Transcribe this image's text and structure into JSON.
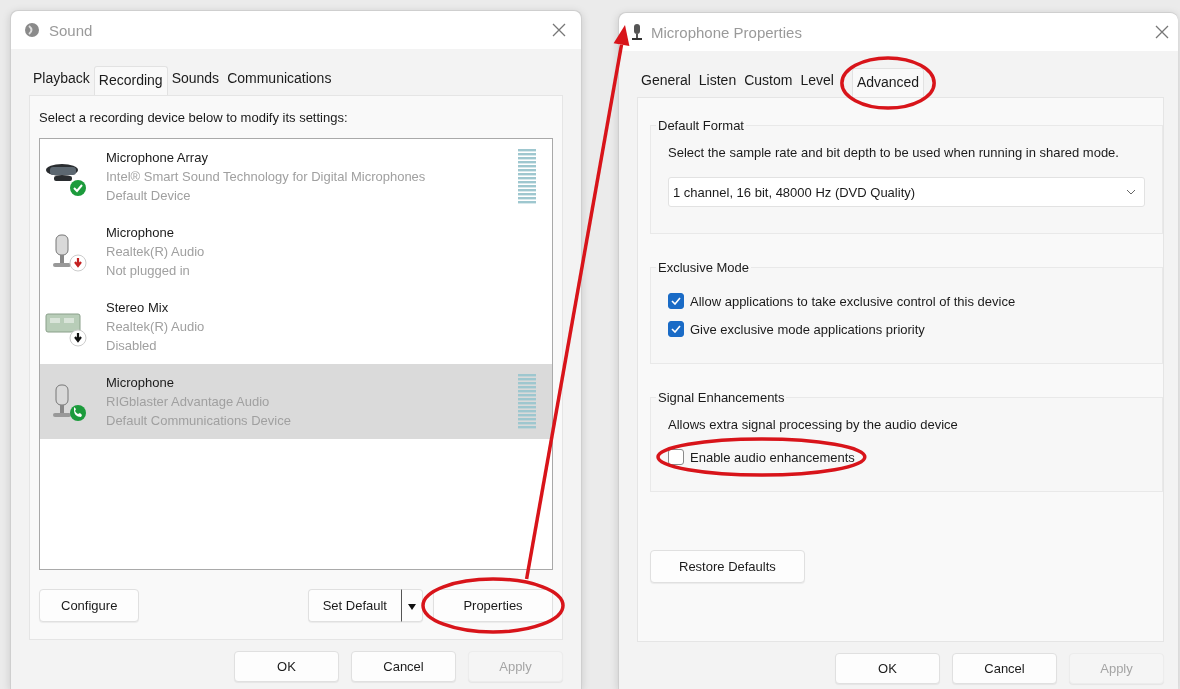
{
  "sound_window": {
    "title": "Sound",
    "tabs": [
      {
        "label": "Playback",
        "selected": false
      },
      {
        "label": "Recording",
        "selected": true
      },
      {
        "label": "Sounds",
        "selected": false
      },
      {
        "label": "Communications",
        "selected": false
      }
    ],
    "instruction": "Select a recording device below to modify its settings:",
    "devices": [
      {
        "name": "Microphone Array",
        "driver": "Intel® Smart Sound Technology for Digital Microphones",
        "status": "Default Device",
        "kind": "webcam",
        "default": true,
        "communications_default": false,
        "unplugged": false,
        "disabled": false,
        "meter": true,
        "selected": false
      },
      {
        "name": "Microphone",
        "driver": "Realtek(R) Audio",
        "status": "Not plugged in",
        "kind": "microphone",
        "default": false,
        "communications_default": false,
        "unplugged": true,
        "disabled": false,
        "meter": false,
        "selected": false
      },
      {
        "name": "Stereo Mix",
        "driver": "Realtek(R) Audio",
        "status": "Disabled",
        "kind": "sound_card",
        "default": false,
        "communications_default": false,
        "unplugged": false,
        "disabled": true,
        "meter": false,
        "selected": false
      },
      {
        "name": "Microphone",
        "driver": "RIGblaster Advantage Audio",
        "status": "Default Communications Device",
        "kind": "microphone",
        "default": false,
        "communications_default": true,
        "unplugged": false,
        "disabled": false,
        "meter": true,
        "selected": true
      }
    ],
    "buttons": [
      {
        "label": "Configure",
        "kind": "plain"
      },
      {
        "label": "Set Default",
        "kind": "split"
      },
      {
        "label": "Properties",
        "kind": "plain",
        "circled": true,
        "arrow": true
      }
    ],
    "footer_buttons": [
      {
        "label": "OK",
        "disabled": false
      },
      {
        "label": "Cancel",
        "disabled": false
      },
      {
        "label": "Apply",
        "disabled": true
      }
    ]
  },
  "properties_window": {
    "title": "Microphone Properties",
    "tabs": [
      {
        "label": "General",
        "selected": false
      },
      {
        "label": "Listen",
        "selected": false
      },
      {
        "label": "Custom",
        "selected": false
      },
      {
        "label": "Level",
        "selected": false
      },
      {
        "label": "Advanced",
        "selected": true,
        "circled": true
      }
    ],
    "groups": [
      {
        "title": "Default Format",
        "description": "Select the sample rate and bit depth to be used when running in shared mode.",
        "dropdown": {
          "value": "1 channel, 16 bit, 48000 Hz (DVD Quality)"
        }
      },
      {
        "title": "Exclusive Mode",
        "options": [
          {
            "label": "Allow applications to take exclusive control of this device",
            "checked": true
          },
          {
            "label": "Give exclusive mode applications priority",
            "checked": true
          }
        ]
      },
      {
        "title": "Signal Enhancements",
        "description": "Allows extra signal processing by the audio device",
        "options": [
          {
            "label": "Enable audio enhancements",
            "checked": false,
            "circled": true
          }
        ]
      }
    ],
    "restore_button": "Restore Defaults",
    "footer_buttons": [
      {
        "label": "OK",
        "disabled": false
      },
      {
        "label": "Cancel",
        "disabled": false
      },
      {
        "label": "Apply",
        "disabled": true
      }
    ]
  }
}
